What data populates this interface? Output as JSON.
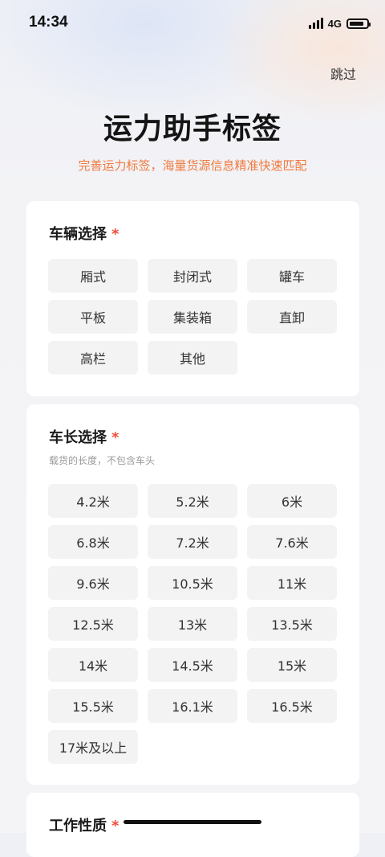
{
  "status_bar": {
    "time": "14:34",
    "network": "4G",
    "battery_level": 0.85
  },
  "header": {
    "skip_label": "跳过",
    "title": "运力助手标签",
    "subtitle": "完善运力标签，海量货源信息精准快速匹配"
  },
  "vehicle_section": {
    "title": "车辆选择",
    "required_mark": "*",
    "options": [
      "厢式",
      "封闭式",
      "罐车",
      "平板",
      "集装箱",
      "直卸",
      "高栏",
      "其他"
    ]
  },
  "length_section": {
    "title": "车长选择",
    "required_mark": "*",
    "hint": "载货的长度，不包含车头",
    "options": [
      "4.2米",
      "5.2米",
      "6米",
      "6.8米",
      "7.2米",
      "7.6米",
      "9.6米",
      "10.5米",
      "11米",
      "12.5米",
      "13米",
      "13.5米",
      "14米",
      "14.5米",
      "15米",
      "15.5米",
      "16.1米",
      "16.5米",
      "17米及以上"
    ]
  },
  "work_section": {
    "title": "工作性质",
    "required_mark": "*"
  },
  "colors": {
    "accent_orange": "#f07a3f",
    "required_red": "#f04c3c",
    "chip_bg": "#f3f3f3"
  }
}
